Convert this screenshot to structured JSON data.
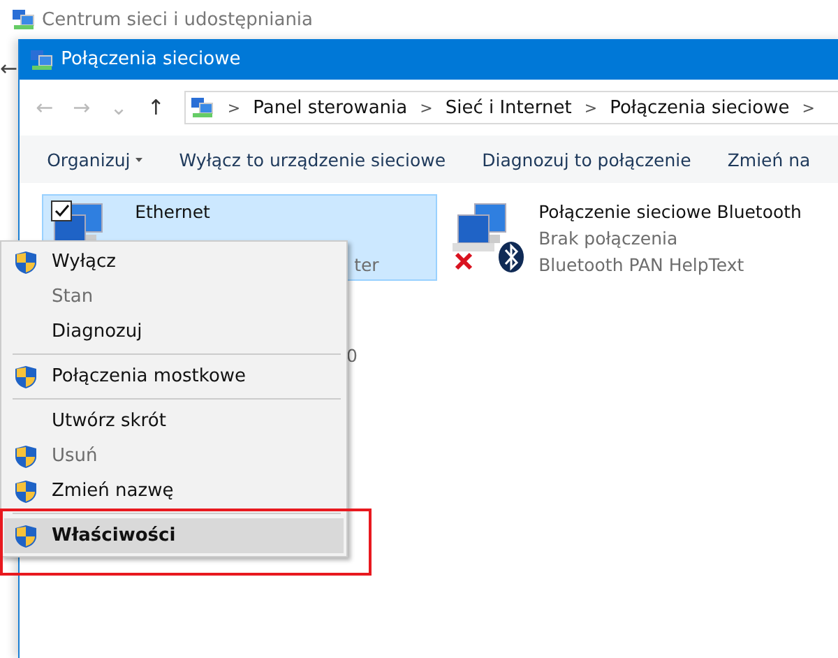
{
  "back_window": {
    "title": "Centrum sieci i udostępniania",
    "back_arrow": "←"
  },
  "window": {
    "title": "Połączenia sieciowe"
  },
  "address_bar": {
    "nav": [
      "←",
      "→",
      "⌄",
      "↑"
    ],
    "crumbs": [
      "Panel sterowania",
      "Sieć i Internet",
      "Połączenia sieciowe"
    ],
    "separator": ">"
  },
  "command_bar": [
    {
      "label": "Organizuj",
      "dropdown": true
    },
    {
      "label": "Wyłącz to urządzenie sieciowe",
      "dropdown": false
    },
    {
      "label": "Diagnozuj to połączenie",
      "dropdown": false
    },
    {
      "label": "Zmień na",
      "dropdown": false
    }
  ],
  "connections": [
    {
      "kind": "ethernet",
      "name": "Ethernet",
      "lines": [
        "ter"
      ],
      "selected": true,
      "checked": true,
      "disconnected": false
    },
    {
      "kind": "bluetooth",
      "name": "Połączenie sieciowe Bluetooth",
      "lines": [
        "Brak połączenia",
        "Bluetooth PAN HelpText"
      ],
      "selected": false,
      "checked": false,
      "disconnected": true
    }
  ],
  "hidden_fragment": "0",
  "context_menu": [
    {
      "kind": "item",
      "label": "Wyłącz",
      "shield": true,
      "disabled": false,
      "selected": false,
      "bold": false
    },
    {
      "kind": "item",
      "label": "Stan",
      "shield": false,
      "disabled": true,
      "selected": false,
      "bold": false
    },
    {
      "kind": "item",
      "label": "Diagnozuj",
      "shield": false,
      "disabled": false,
      "selected": false,
      "bold": false
    },
    {
      "kind": "separator"
    },
    {
      "kind": "item",
      "label": "Połączenia mostkowe",
      "shield": true,
      "disabled": false,
      "selected": false,
      "bold": false
    },
    {
      "kind": "separator"
    },
    {
      "kind": "item",
      "label": "Utwórz skrót",
      "shield": false,
      "disabled": false,
      "selected": false,
      "bold": false
    },
    {
      "kind": "item",
      "label": "Usuń",
      "shield": true,
      "disabled": true,
      "selected": false,
      "bold": false
    },
    {
      "kind": "item",
      "label": "Zmień nazwę",
      "shield": true,
      "disabled": false,
      "selected": false,
      "bold": false
    },
    {
      "kind": "separator"
    },
    {
      "kind": "item",
      "label": "Właściwości",
      "shield": true,
      "disabled": false,
      "selected": true,
      "bold": true
    }
  ],
  "highlight_frame": true
}
